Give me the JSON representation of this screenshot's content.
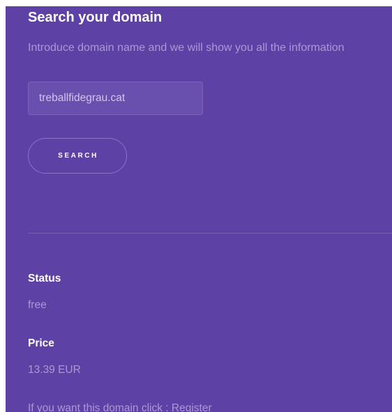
{
  "header": {
    "title": "Search your domain",
    "subtitle": "Introduce domain name and we will show you all the information"
  },
  "search": {
    "value": "treballfidegrau.cat",
    "button_label": "SEARCH"
  },
  "results": {
    "status_label": "Status",
    "status_value": "free",
    "price_label": "Price",
    "price_value": "13.39 EUR",
    "register_prompt": "If you want this domain click : ",
    "register_link": "Register"
  },
  "colors": {
    "panel_background": "#5e41a5",
    "muted_text": "#a89ad6",
    "heading_text": "#ffffff"
  }
}
